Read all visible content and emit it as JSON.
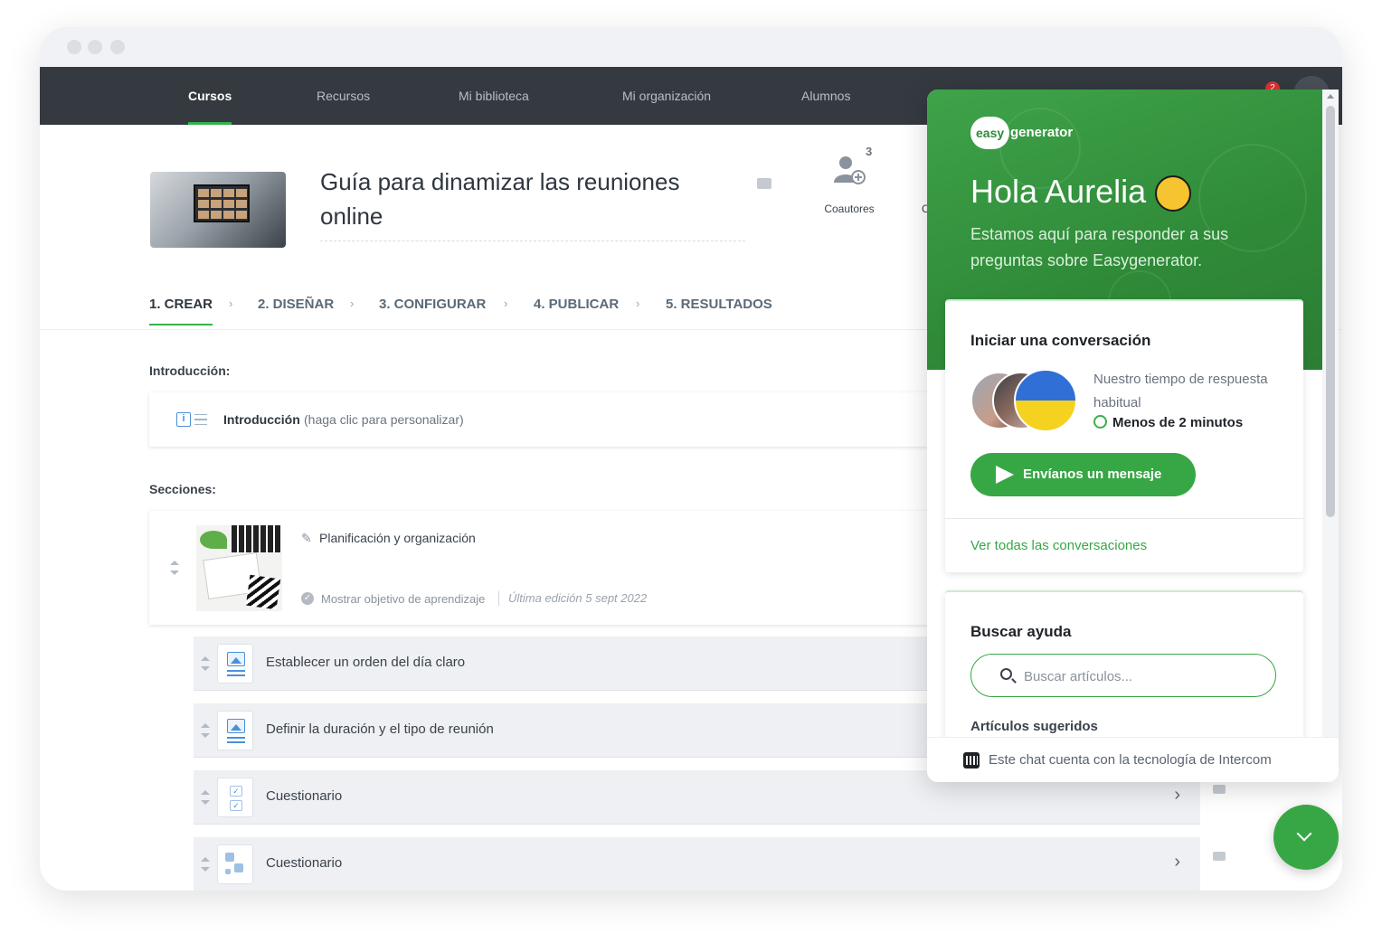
{
  "nav": {
    "items": [
      "Cursos",
      "Recursos",
      "Mi biblioteca",
      "Mi organización",
      "Alumnos"
    ],
    "notification_count": "2"
  },
  "course": {
    "title": "Guía para dinamizar las reuniones online",
    "coauthors_count": "3",
    "coauthors_label": "Coautores",
    "partial_label": "C"
  },
  "steps": [
    "1. CREAR",
    "2. DISEÑAR",
    "3. CONFIGURAR",
    "4. PUBLICAR",
    "5. RESULTADOS"
  ],
  "intro": {
    "section_label": "Introducción:",
    "title": "Introducción",
    "hint": "(haga clic para personalizar)"
  },
  "sections": {
    "label": "Secciones:",
    "section_title": "Planificación y organización",
    "objective": "Mostrar objetivo de aprendizaje",
    "last_edit": "Última edición 5 sept 2022",
    "items": [
      {
        "title": "Establecer un orden del día claro",
        "icon": "image-text-icon"
      },
      {
        "title": "Definir la duración y el tipo de reunión",
        "icon": "image-text-icon"
      },
      {
        "title": "Cuestionario",
        "icon": "checklist-icon"
      },
      {
        "title": "Cuestionario",
        "icon": "puzzle-icon"
      }
    ]
  },
  "intercom": {
    "logo_easy": "easy",
    "logo_generator": "generator",
    "greeting": "Hola Aurelia",
    "subtitle": "Estamos aquí para responder a sus preguntas sobre Easygenerator.",
    "conversation": {
      "title": "Iniciar una conversación",
      "response_text": "Nuestro tiempo de respuesta habitual",
      "response_time": "Menos de 2 minutos",
      "send_button": "Envíanos un mensaje",
      "see_all": "Ver todas las conversaciones"
    },
    "help": {
      "title": "Buscar ayuda",
      "search_placeholder": "Buscar artículos...",
      "suggested": "Artículos sugeridos"
    },
    "footer": "Este chat cuenta con la tecnología de Intercom"
  },
  "colors": {
    "accent": "#37b24d",
    "nav_bg": "#343a40",
    "intercom_green": "#2f8a38"
  }
}
